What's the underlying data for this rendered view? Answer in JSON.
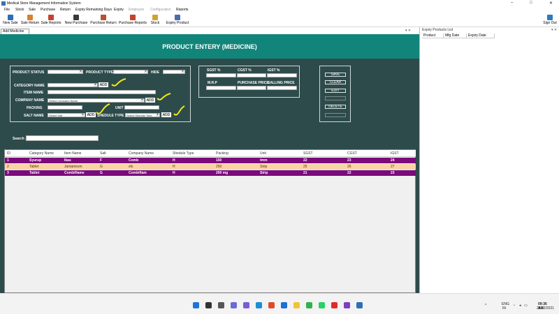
{
  "window": {
    "title": "Medical Store Management Information System",
    "minimize": "–",
    "maximize": "□",
    "close": "✕"
  },
  "menu": [
    {
      "label": "File",
      "disabled": false
    },
    {
      "label": "Stock",
      "disabled": false
    },
    {
      "label": "Sale",
      "disabled": false
    },
    {
      "label": "Purchase",
      "disabled": false
    },
    {
      "label": "Return",
      "disabled": false
    },
    {
      "label": "Expiry Remaining Days",
      "disabled": false
    },
    {
      "label": "Expiry",
      "disabled": false
    },
    {
      "label": "Employee",
      "disabled": true
    },
    {
      "label": "Configuration",
      "disabled": true
    },
    {
      "label": "Reports",
      "disabled": false
    }
  ],
  "toolbar": {
    "new_sale": "New Sale",
    "sale_return": "Sale Return",
    "sale_reports": "Sale Reports",
    "new_purchase": "New Purchase",
    "purchase_return": "Purchase Return",
    "purchase_reports": "Purchase Reports",
    "stock": "Stock",
    "expiry_product": "Expiry Product",
    "sign_out": "Sign Out"
  },
  "tabs": {
    "active": "Add Medicine",
    "controls": "▾ ✕"
  },
  "side_panel": {
    "title": "Expiry Products List",
    "controls": "▾ ✕",
    "columns": [
      "Product",
      "Mfg Date",
      "Expiry Date"
    ]
  },
  "form": {
    "title": "PRODUCT ENTERY (MEDICINE)",
    "labels": {
      "product_status": "PRODUCT STATUS",
      "product_type": "PRODUCT TYPE",
      "hide": "HIDE",
      "category_name": "CATEGORY NAME",
      "item_name": "ITEM NAME",
      "company_name": "COMPANY NAME",
      "packing": "PACKING",
      "unit": "UNIT",
      "salt_name": "SALT NAME",
      "shedule_type": "SHEDULE TYPE",
      "sgst": "SGST %",
      "cgst": "CGST %",
      "igst": "IGST %",
      "mrp": "M.R.P",
      "purchase_price": "PURCHASE PRICE",
      "selling_price": "SALLING PRICE",
      "search": "Search :"
    },
    "placeholders": {
      "company_name": "Select Company Name",
      "salt_name": "Select Salt",
      "shedule_type": "Select Shedule Type"
    },
    "add_label": "ADD",
    "actions": {
      "save": "SAVE",
      "clear": "CLEAR",
      "edit": "EDIT",
      "delete": "DELETE"
    }
  },
  "grid": {
    "columns": [
      "ID",
      "Category Name",
      "Item Name",
      "Salt",
      "Company Name",
      "Shedule Type",
      "Packing",
      "Unit",
      "SGST",
      "CGST",
      "IGST"
    ],
    "rows": [
      [
        "1",
        "Syurup",
        "Ikas",
        "F",
        "Comb",
        "H",
        "150",
        "tmm",
        "22",
        "23",
        "24"
      ],
      [
        "2",
        "Tablet",
        "Jantamicen",
        "G",
        "sfs",
        "H",
        "250",
        "Strip",
        "25",
        "26",
        "27"
      ],
      [
        "3",
        "Tablet",
        "Combiflame",
        "G",
        "Combiflam",
        "H",
        "200 mg",
        "Strip",
        "21",
        "22",
        "23"
      ]
    ],
    "row_colors": [
      "#7b0a7b",
      "#f7d3a6",
      "#7b0a7b"
    ],
    "row_text_colors": [
      "#ffffff",
      "#5a2a00",
      "#ffffff"
    ]
  },
  "tray": {
    "lang": "ENG",
    "region": "IN",
    "time": "09:36 AM",
    "date": "28/12/2021"
  },
  "colors": {
    "panel": "#2e4b4b",
    "header_band": "#12857a",
    "highlight_scribble": "#f2e81a"
  }
}
